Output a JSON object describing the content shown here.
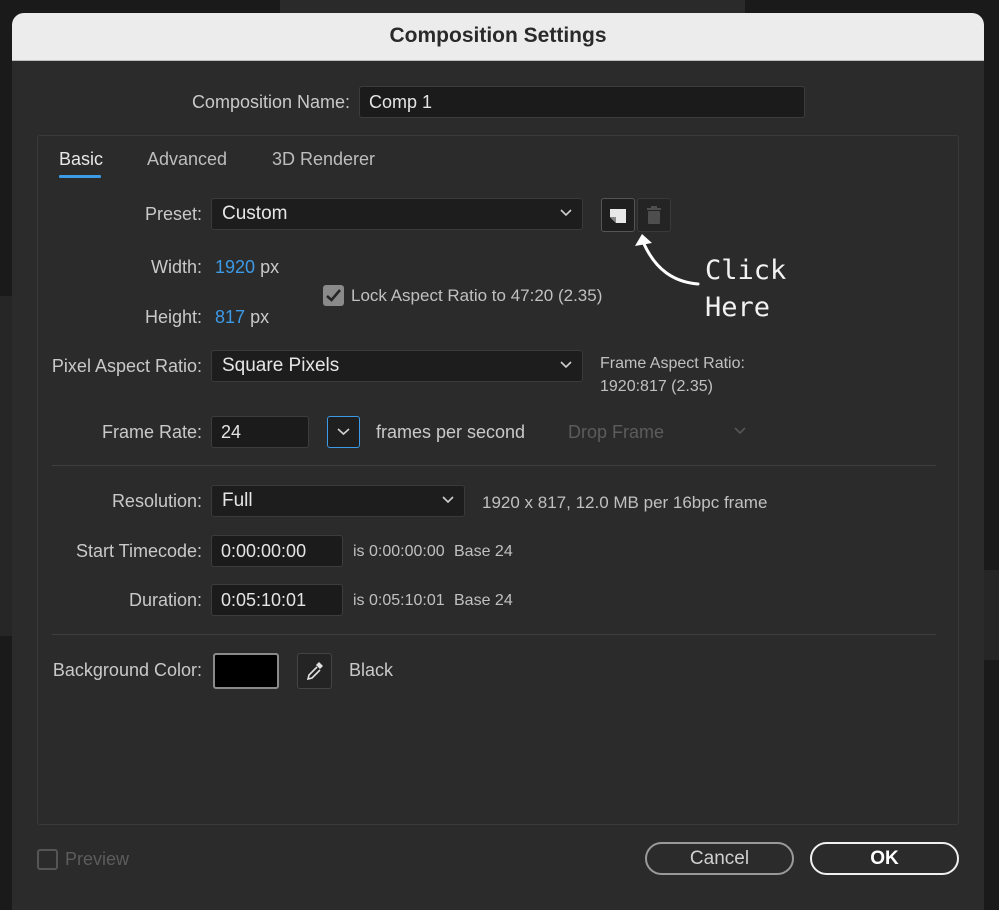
{
  "dialog": {
    "title": "Composition Settings"
  },
  "comp_name": {
    "label": "Composition Name:",
    "value": "Comp 1"
  },
  "tabs": [
    {
      "label": "Basic",
      "active": true
    },
    {
      "label": "Advanced",
      "active": false
    },
    {
      "label": "3D Renderer",
      "active": false
    }
  ],
  "preset": {
    "label": "Preset:",
    "value": "Custom",
    "save_icon": "save-preset-icon",
    "delete_icon": "trash-icon"
  },
  "width": {
    "label": "Width:",
    "value": "1920",
    "unit": "px"
  },
  "height": {
    "label": "Height:",
    "value": "817",
    "unit": "px"
  },
  "lock_aspect": {
    "label": "Lock Aspect Ratio to 47:20 (2.35)",
    "checked": true
  },
  "annotation": {
    "line1": "Click",
    "line2": "Here"
  },
  "pixel_aspect": {
    "label": "Pixel Aspect Ratio:",
    "value": "Square Pixels",
    "frame_aspect_label": "Frame Aspect Ratio:",
    "frame_aspect_value": "1920:817 (2.35)"
  },
  "frame_rate": {
    "label": "Frame Rate:",
    "value": "24",
    "unit_label": "frames per second",
    "drop_frame": "Drop Frame"
  },
  "resolution": {
    "label": "Resolution:",
    "value": "Full",
    "info": "1920 x 817, 12.0 MB per 16bpc frame"
  },
  "start_timecode": {
    "label": "Start Timecode:",
    "value": "0:00:00:00",
    "is_label": "is 0:00:00:00",
    "base": "Base 24"
  },
  "duration": {
    "label": "Duration:",
    "value": "0:05:10:01",
    "is_label": "is 0:05:10:01",
    "base": "Base 24"
  },
  "background": {
    "label": "Background Color:",
    "color_name": "Black",
    "color": "#000000"
  },
  "footer": {
    "preview_label": "Preview",
    "preview_checked": false,
    "cancel_label": "Cancel",
    "ok_label": "OK"
  },
  "colors": {
    "accent": "#3c9ae6",
    "dialog_bg": "#2b2b2b",
    "titlebar_bg": "#ececec"
  }
}
